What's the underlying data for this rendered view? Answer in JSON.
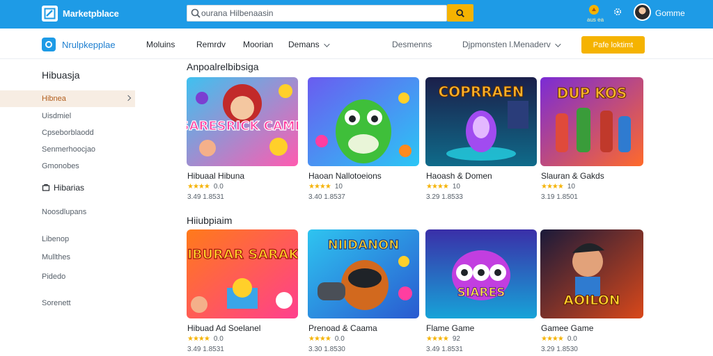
{
  "topbar": {
    "brand": "Marketpblace",
    "search_value": "ourana Hilbenaasin",
    "bell_label": "aus ea",
    "username": "Gomme",
    "colors": {
      "bar": "#1e9be6",
      "accent": "#f5b301"
    }
  },
  "nav": {
    "brand": "Nrulpkepplae",
    "items": [
      "Moluins",
      "Remrdv",
      "Moorian"
    ],
    "dropdown": "Demans",
    "link": "Desmenns",
    "dropdown2": "Djpmonsten l.Menaderv",
    "cta": "Pafe loktimt"
  },
  "sidebar": {
    "heading": "Hibuasja",
    "active": "Hibnea",
    "items": [
      "Uisdmiel",
      "Cpseborblaodd",
      "Senmerhoocjao",
      "Gmonobes"
    ],
    "bag_label": "Hibarias",
    "groups": [
      "Noosdlupans",
      "Libenop",
      "Mullthes",
      "Pidedo",
      "Sorenett"
    ]
  },
  "sections": [
    {
      "title": "Anpoalrelbibsiga",
      "cards": [
        {
          "title": "Hibuaal Hibuna",
          "rating": "0.0",
          "meta": "3.49 1.8531",
          "art": "SARESRICK CAMB"
        },
        {
          "title": "Haoan Nallotoeions",
          "rating": "10",
          "meta": "3.40 1.8537",
          "art": ""
        },
        {
          "title": "Haoash & Domen",
          "rating": "10",
          "meta": "3.29 1.8533",
          "art": "COPRRAEN"
        },
        {
          "title": "Slauran & Gakds",
          "rating": "10",
          "meta": "3.19 1.8501",
          "art": "DUP KOS"
        }
      ]
    },
    {
      "title": "Hiiubpiaim",
      "cards": [
        {
          "title": "Hibuad Ad Soelanel",
          "rating": "0.0",
          "meta": "3.49 1.8531",
          "art": "HIBURAR SARAKS"
        },
        {
          "title": "Prenoad & Caama",
          "rating": "0.0",
          "meta": "3.30 1.8530",
          "art": "NIIDANON"
        },
        {
          "title": "Flame Game",
          "rating": "92",
          "meta": "3.49 1.8531",
          "art": "SIARES"
        },
        {
          "title": "Gamee Game",
          "rating": "0.0",
          "meta": "3.29 1.8530",
          "art": "AOILON"
        }
      ]
    }
  ],
  "stars_glyph": "★★★★"
}
